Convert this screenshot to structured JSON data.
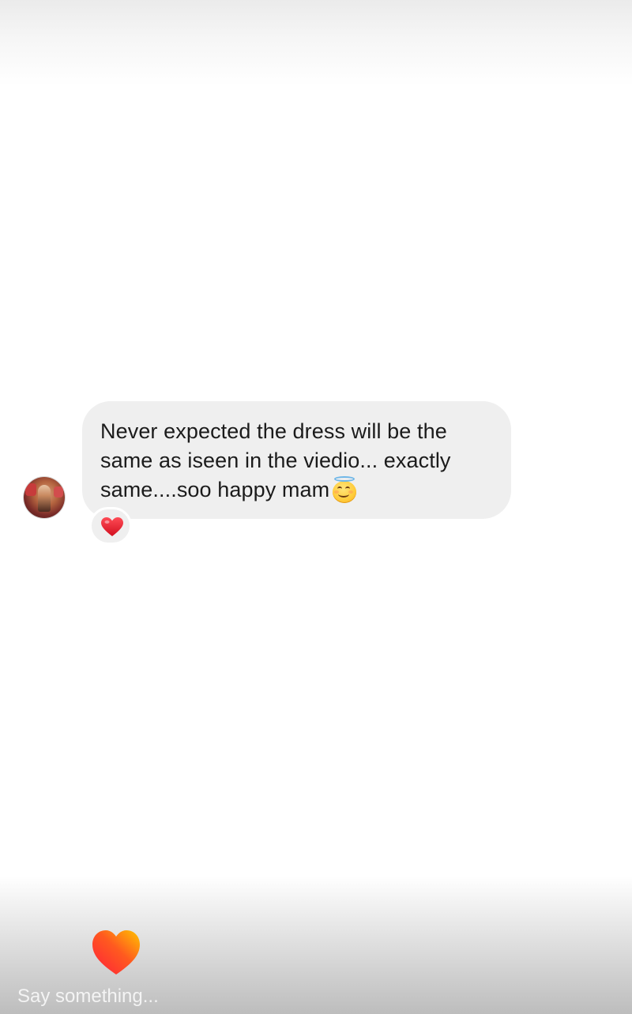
{
  "message": {
    "lines": [
      "Never expected the dress will be the",
      "same as iseen in the viedio... exactly",
      "same....soo happy mam"
    ],
    "emoji": "smiling-face-with-halo",
    "reaction_icon": "red-heart-icon",
    "sender_avatar_icon": "user-avatar"
  },
  "footer": {
    "reply_placeholder": "Say something...",
    "like_icon": "gradient-heart-icon"
  },
  "colors": {
    "bubble_bg": "#efefef",
    "message_text": "#1b1b1b",
    "reaction_heart": "#e8202f",
    "like_heart_top": "#ff1e3c",
    "like_heart_bottom": "#ffc400"
  }
}
